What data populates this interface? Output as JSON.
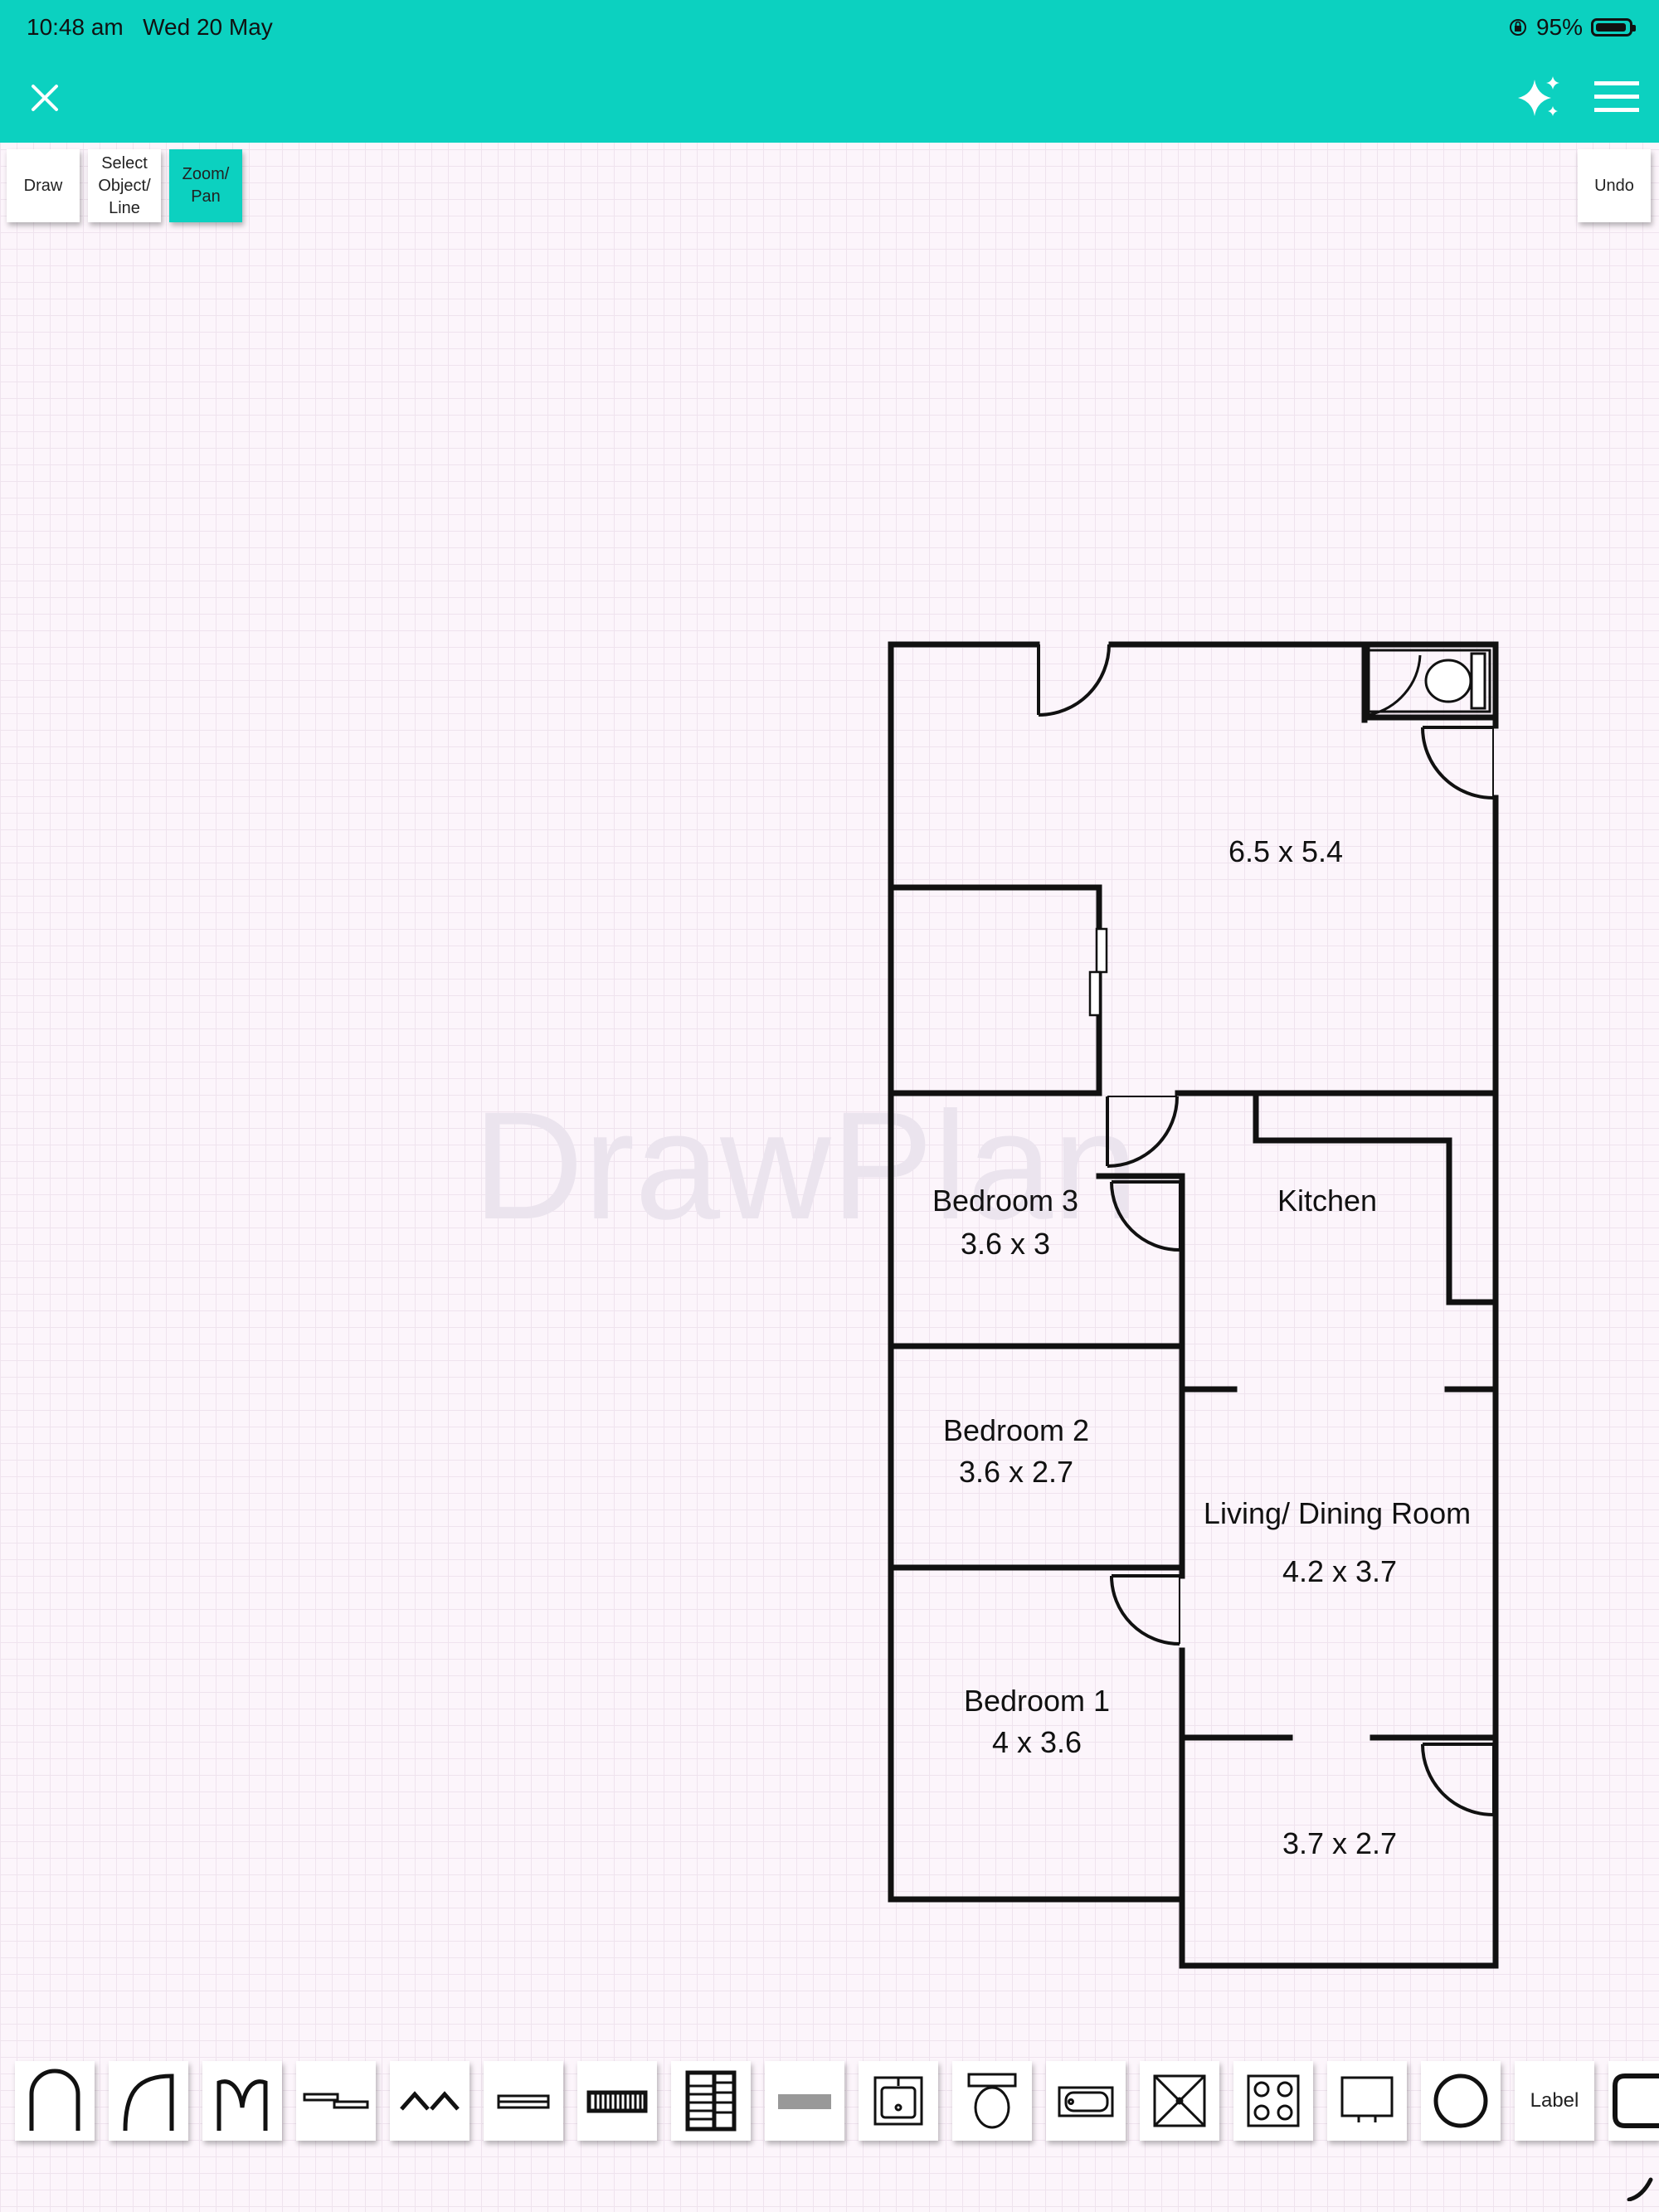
{
  "status_bar": {
    "time": "10:48 am",
    "date": "Wed 20 May",
    "battery": "95%",
    "icons": [
      "orientation-lock-icon",
      "battery-icon"
    ]
  },
  "app_bar": {
    "color": "#0cd1c0",
    "icons": [
      "close-icon",
      "sparkles-icon",
      "hamburger-menu-icon"
    ]
  },
  "toolbar": {
    "draw": "Draw",
    "select": "Select Object/ Line",
    "zoom": "Zoom/ Pan",
    "undo": "Undo",
    "active": "Zoom/ Pan"
  },
  "watermark": "DrawPlan",
  "rooms": [
    {
      "name": "",
      "size": "6.5 x 5.4"
    },
    {
      "name": "Bedroom 3",
      "size": "3.6 x 3"
    },
    {
      "name": "Kitchen",
      "size": ""
    },
    {
      "name": "Bedroom 2",
      "size": "3.6 x 2.7"
    },
    {
      "name": "Living/ Dining Room",
      "size": "4.2 x 3.7"
    },
    {
      "name": "Bedroom 1",
      "size": "4 x 3.6"
    },
    {
      "name": "",
      "size": "3.7 x 2.7"
    }
  ],
  "palette": {
    "items": [
      "door-icon",
      "door-left-icon",
      "double-door-icon",
      "sliding-door-icon",
      "bifold-door-icon",
      "window-icon",
      "stairs-icon",
      "stairs-turn-icon",
      "wall-block-icon",
      "sink-icon",
      "toilet-icon",
      "bathtub-icon",
      "shower-icon",
      "stove-icon",
      "tv-icon",
      "circle-icon",
      "label-item",
      "shape-partial-icon"
    ],
    "label": "Label"
  }
}
